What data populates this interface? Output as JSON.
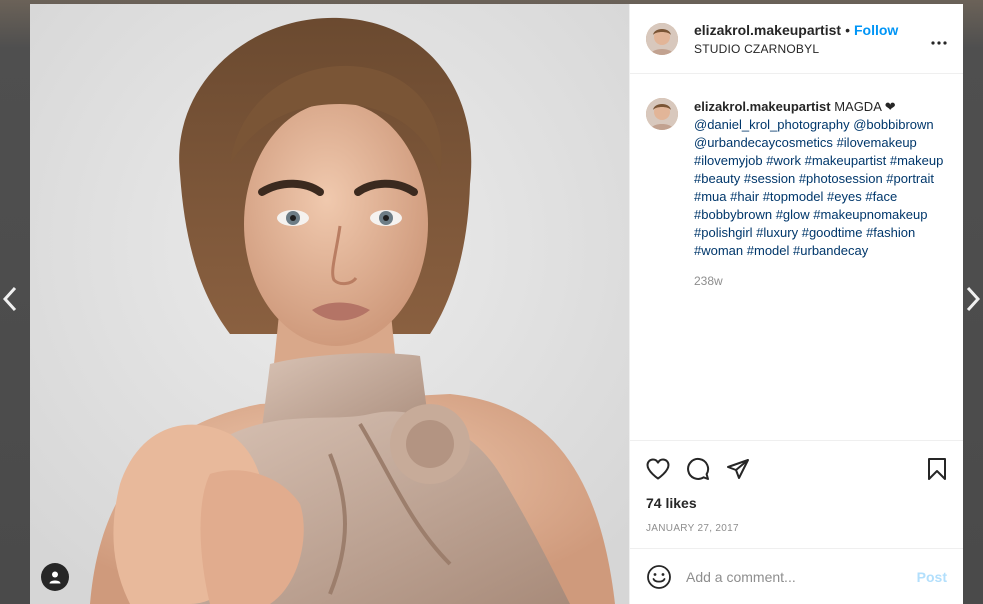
{
  "nav": {
    "prev_icon": "chevron-left-icon",
    "next_icon": "chevron-right-icon"
  },
  "post": {
    "image_icon": "user-tag-icon"
  },
  "header": {
    "username": "elizakrol.makeupartist",
    "separator": "•",
    "follow_label": "Follow",
    "location": "STUDIO CZARNOBYL",
    "more_icon": "more-options-icon"
  },
  "caption": {
    "username": "elizakrol.makeupartist",
    "text": "MAGDA ❤",
    "mention_1": "@daniel_krol_photography",
    "mention_2": "@bobbibrown",
    "mention_3": "@urbandecaycosmetics",
    "hashtags": [
      "#ilovemakeup",
      "#ilovemyjob",
      "#work",
      "#makeupartist",
      "#makeup",
      "#beauty",
      "#session",
      "#photosession",
      "#portrait",
      "#mua",
      "#hair",
      "#topmodel",
      "#eyes",
      "#face",
      "#bobbybrown",
      "#glow",
      "#makeupnomakeup",
      "#polishgirl",
      "#luxury",
      "#goodtime",
      "#fashion",
      "#woman",
      "#model",
      "#urbandecay"
    ],
    "time_ago": "238w"
  },
  "actions": {
    "like_icon": "heart-icon",
    "comment_icon": "comment-icon",
    "share_icon": "share-icon",
    "save_icon": "bookmark-icon",
    "likes": "74 likes",
    "date": "JANUARY 27, 2017"
  },
  "comment_box": {
    "emoji_icon": "emoji-icon",
    "placeholder": "Add a comment...",
    "post_label": "Post"
  },
  "colors": {
    "accent": "#0095f6",
    "hashtag": "#00376b",
    "post_disabled": "#b2dffc"
  }
}
